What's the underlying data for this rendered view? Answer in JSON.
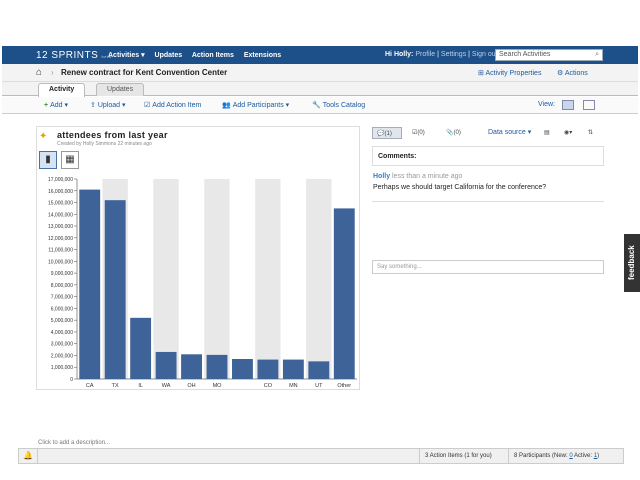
{
  "topnav": {
    "logo": "12 SPRINTS",
    "logo_suffix": "beta",
    "items": [
      "Activities ▾",
      "Updates",
      "Action Items",
      "Extensions"
    ],
    "greeting": "Hi Holly:",
    "profile": "Profile",
    "settings": "Settings",
    "signout": "Sign out",
    "search_placeholder": "Search Activities"
  },
  "titlebar": {
    "title": "Renew contract for Kent Convention Center",
    "activity_properties": "Activity Properties",
    "actions": "Actions"
  },
  "tabs": [
    "Activity",
    "Updates"
  ],
  "toolbar": {
    "add": "Add",
    "upload": "Upload",
    "add_action_item": "Add Action Item",
    "add_participants": "Add Participants",
    "tools_catalog": "Tools Catalog",
    "view": "View:"
  },
  "panel": {
    "title": "attendees from last year",
    "meta": "Created by Holly Simmons 22 minutes ago"
  },
  "chart_data": {
    "type": "bar",
    "categories": [
      "CA",
      "TX",
      "IL",
      "WA",
      "OH",
      "MO",
      "",
      "CO",
      "MN",
      "UT",
      "Other"
    ],
    "values": [
      16100000,
      15200000,
      5200000,
      2300000,
      2100000,
      2050000,
      1700000,
      1650000,
      1650000,
      1500000,
      14500000
    ],
    "ylim": [
      0,
      17000000
    ],
    "yticks": [
      "0",
      "1,000,000",
      "2,000,000",
      "3,000,000",
      "4,000,000",
      "5,000,000",
      "6,000,000",
      "7,000,000",
      "8,000,000",
      "9,000,000",
      "10,000,000",
      "11,000,000",
      "12,000,000",
      "13,000,000",
      "14,000,000",
      "15,000,000",
      "16,000,000",
      "17,000,000"
    ],
    "bar_color": "#3e6398",
    "title": "",
    "xlabel": "",
    "ylabel": ""
  },
  "right": {
    "comments_count": "(1)",
    "tab2_count": "(0)",
    "tab3_count": "(0)",
    "data_source": "Data source",
    "comments_header": "Comments:",
    "author": "Holly",
    "time": "less than a minute ago",
    "comment": "Perhaps we should target California for the conference?",
    "say_placeholder": "Say something..."
  },
  "feedback": "feedback",
  "description_placeholder": "Click to add a description...",
  "statusbar": {
    "action_items": "3 Action Items (1 for you)",
    "participants_prefix": "8 Participants (New: ",
    "new_count": "0",
    "active_label": " Active: ",
    "active_count": "1",
    "suffix": ")"
  }
}
